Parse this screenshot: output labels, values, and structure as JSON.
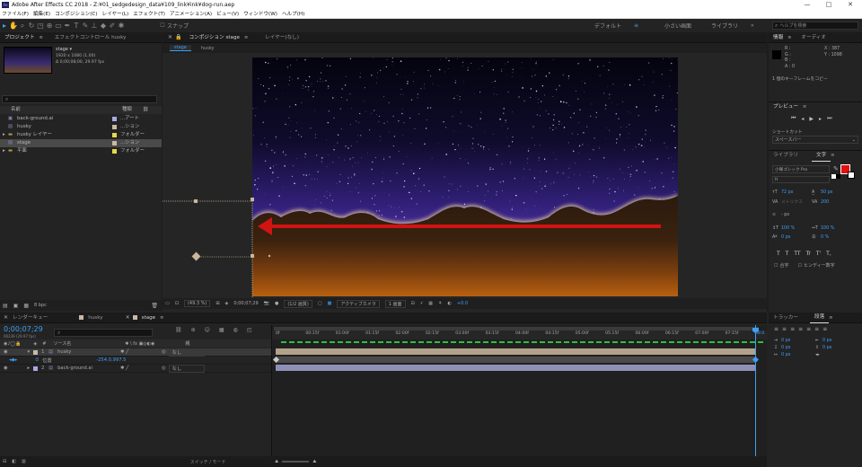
{
  "window": {
    "title": "Adobe After Effects CC 2018 - Z:¥01_sedgedesign_data¥109_link¥ink¥dog-run.aep",
    "btn_min": "—",
    "btn_max": "□",
    "btn_close": "✕"
  },
  "menu": [
    "ファイル(F)",
    "編集(E)",
    "コンポジション(C)",
    "レイヤー(L)",
    "エフェクト(T)",
    "アニメーション(A)",
    "ビュー(V)",
    "ウィンドウ(W)",
    "ヘルプ(H)"
  ],
  "toolbar": {
    "snap": "スナップ",
    "workspaces": [
      "デフォルト",
      "小さい画面",
      "ライブラリ"
    ],
    "search_placeholder": "ヘルプを検索"
  },
  "project": {
    "tab1": "プロジェクト",
    "tab2": "エフェクトコントロール husky",
    "comp_name": "stage ▾",
    "info1": "1920 x 1080 (1.00)",
    "info2": "Δ 0;00;08;00, 29.97 fps",
    "col_name": "名前",
    "col_type": "種類",
    "items": [
      {
        "name": "back-ground.ai",
        "type": "...アート",
        "color": "#a9a9e8",
        "icon": "ai"
      },
      {
        "name": "husky",
        "type": "...ション",
        "color": "#c9b9a6",
        "icon": "comp"
      },
      {
        "name": "husky レイヤー",
        "type": "フォルダー",
        "color": "#e8d84a",
        "icon": "folder"
      },
      {
        "name": "stage",
        "type": "...ション",
        "color": "#c9b9a6",
        "icon": "comp"
      },
      {
        "name": "平面",
        "type": "フォルダー",
        "color": "#e8d84a",
        "icon": "folder"
      }
    ],
    "bpc": "8 bpc"
  },
  "composition": {
    "tab1": "コンポジション stage",
    "tab2": "レイヤー(なし)",
    "crumbs": [
      "stage",
      "husky"
    ],
    "zoom": "(49.3 %)",
    "timecode": "0;00;07;29",
    "resolution": "(1/2 画質)",
    "camera": "アクティブカメラ",
    "view": "1 画面",
    "exposure": "+0.0"
  },
  "info": {
    "tab1": "情報",
    "tab2": "オーディオ",
    "R": "R :",
    "G": "G :",
    "B": "B :",
    "A": "A : 0",
    "X": "X : 387",
    "Y": "Y : 1098",
    "status": "1 個のキーフレームをコピー"
  },
  "preview": {
    "title": "プレビュー",
    "shortcut_label": "ショートカット",
    "shortcut_value": "スペースバー"
  },
  "character": {
    "tab_lib": "ライブラリ",
    "tab_char": "文字",
    "font": "小塚ゴシック Pro",
    "style": "H",
    "size": "72 px",
    "leading": "50 px",
    "kern": "メトリクス",
    "track": "200",
    "unit": "- px",
    "vscale": "100 %",
    "hscale": "100 %",
    "baseline": "0 px",
    "tsume": "0 %",
    "styles": [
      "T",
      "T",
      "TT",
      "Tr",
      "T'",
      "T,"
    ],
    "fill_color": "#e21010",
    "opt1": "合字",
    "opt2": "ヒンディー数字"
  },
  "paragraph": {
    "tab1": "トラッカー",
    "tab2": "段落",
    "v1": "0 px",
    "v2": "0 px",
    "v3": "0 px",
    "v4": "0 px",
    "v5": "0 px"
  },
  "timeline": {
    "tabs": [
      "レンダーキュー",
      "husky",
      "stage"
    ],
    "timecode": "0;00;07;29",
    "subtime": "00239 (29.97 fps)",
    "col_source": "ソース名",
    "col_parent": "親",
    "layers": [
      {
        "num": "1",
        "name": "husky",
        "parent": "なし",
        "color": "#c9b9a6"
      },
      {
        "num": "2",
        "name": "back-ground.ai",
        "parent": "なし",
        "color": "#a9a9e8"
      }
    ],
    "prop_name": "位置",
    "prop_value": "-254.0,997.5",
    "ruler": [
      "0f",
      "00:15f",
      "01:00f",
      "01:15f",
      "02:00f",
      "02:15f",
      "03:00f",
      "03:15f",
      "04:00f",
      "04:15f",
      "05:00f",
      "05:15f",
      "06:00f",
      "06:15f",
      "07:00f",
      "07:15f",
      "08:0"
    ],
    "footer": "スイッチ / モード"
  },
  "colors": {
    "accent": "#3d9ff5",
    "bar1": "#b3a28a",
    "bar2": "#8f8fb6",
    "arrow": "#d01414"
  }
}
